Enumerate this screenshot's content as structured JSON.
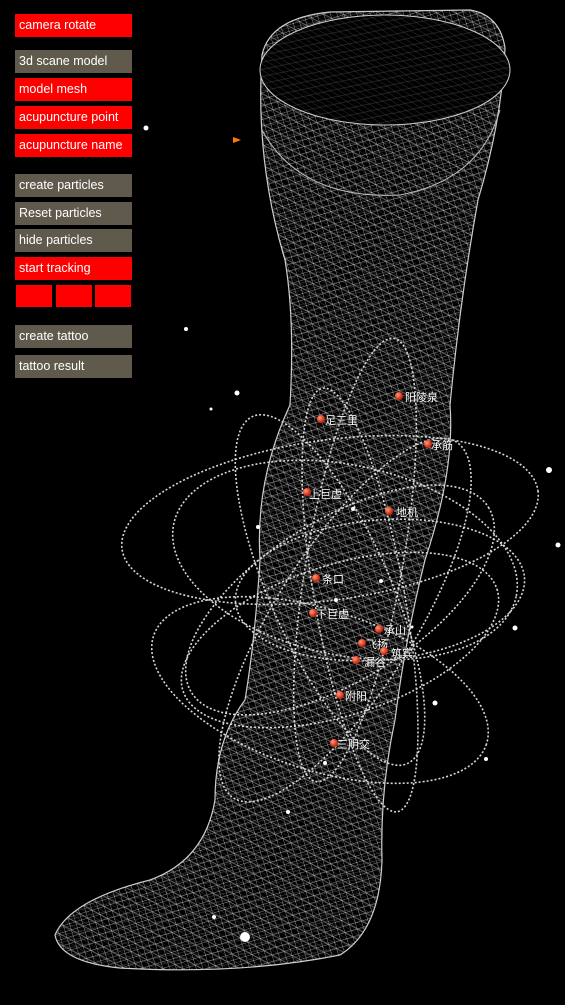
{
  "menu": {
    "camera_rotate": "camera rotate",
    "scene_model": "3d scane model",
    "model_mesh": "model mesh",
    "acupuncture_point": "acupuncture point",
    "acupuncture_name": "acupuncture name",
    "create_particles": "create particles",
    "reset_particles": "Reset particles",
    "hide_particles": "hide particles",
    "start_tracking": "start tracking",
    "create_tattoo": "create tattoo",
    "tattoo_result": "tattoo result"
  },
  "colors": {
    "accent": "#ff0000",
    "button_grey": "#5f5a4c",
    "background": "#000000",
    "point": "#d22a10"
  },
  "acupoints": [
    {
      "name": "阳陵泉"
    },
    {
      "name": "足三里"
    },
    {
      "name": "承筋"
    },
    {
      "name": "上巨虚"
    },
    {
      "name": "地机"
    },
    {
      "name": "条口"
    },
    {
      "name": "下巨虚"
    },
    {
      "name": "承山"
    },
    {
      "name": "飞扬"
    },
    {
      "name": "筑宾"
    },
    {
      "name": "漏谷"
    },
    {
      "name": "附阳"
    },
    {
      "name": "三阴交"
    }
  ]
}
